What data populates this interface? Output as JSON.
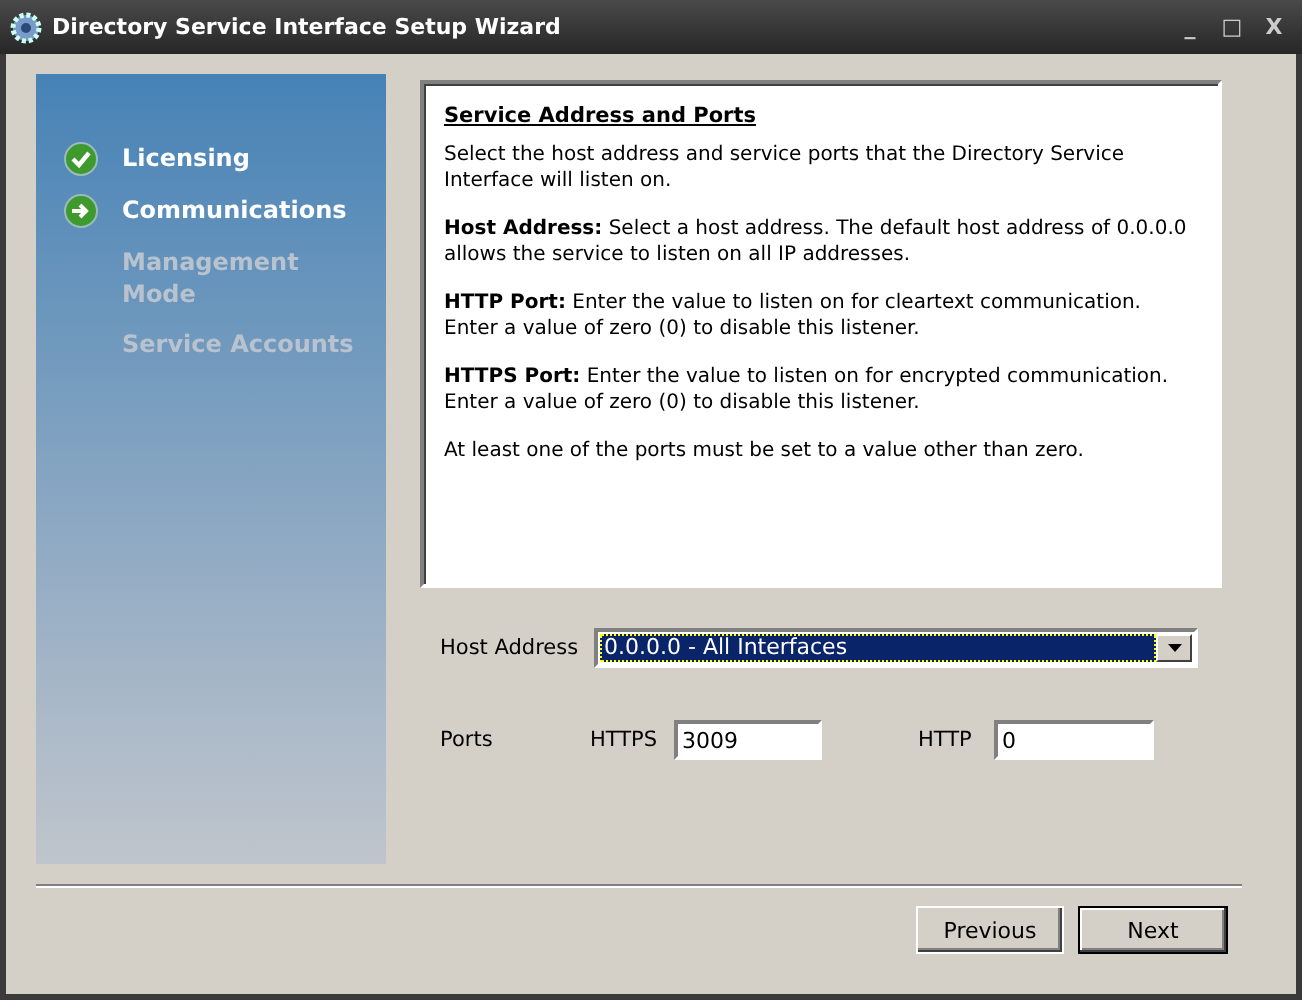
{
  "window": {
    "title": "Directory Service Interface Setup Wizard",
    "controls": [
      "_",
      "□",
      "X"
    ]
  },
  "steps": [
    {
      "label": "Licensing",
      "done": true,
      "current": false
    },
    {
      "label": "Communications",
      "done": false,
      "current": true
    },
    {
      "label": "Management Mode",
      "done": false,
      "current": false
    },
    {
      "label": "Service Accounts",
      "done": false,
      "current": false
    }
  ],
  "help": {
    "heading": "Service Address and Ports",
    "paragraphs": [
      "Select the host address and service ports that the Directory Service Interface will listen on.",
      "**Host Address:** Select a host address.  The default host address of 0.0.0.0 allows the service to listen on all IP addresses.",
      "**HTTP Port:** Enter the value to listen on for cleartext communication.  Enter a value of zero (0) to disable this listener.",
      "**HTTPS Port:** Enter the value to listen on for encrypted communication.  Enter a value of zero (0) to disable this listener.",
      "At least one of the ports must be set to a value other than zero."
    ]
  },
  "host_address": {
    "label": "Host Address",
    "value": "0.0.0.0 - All Interfaces"
  },
  "ports": {
    "label": "Ports",
    "https_label": "HTTPS",
    "https_value": "3009",
    "http_label": "HTTP",
    "http_value": "0"
  },
  "buttons": [
    {
      "label": "Previous",
      "default": false
    },
    {
      "label": "Next",
      "default": true
    }
  ]
}
